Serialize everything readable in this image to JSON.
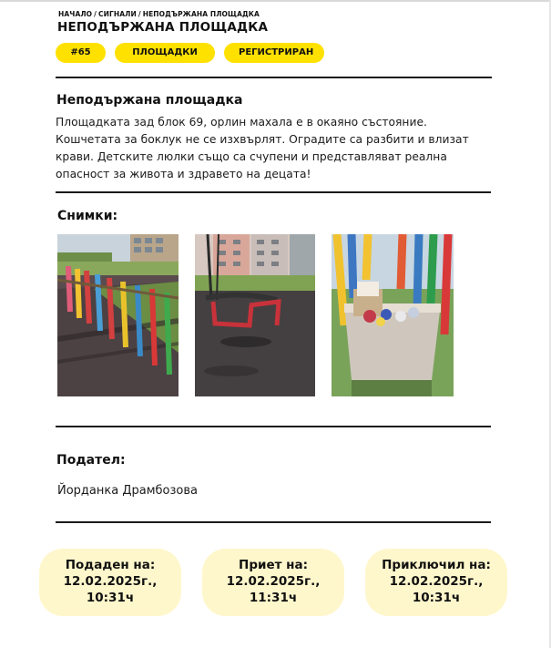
{
  "breadcrumb": {
    "home": "НАЧАЛО",
    "signals": "СИГНАЛИ",
    "current": "НЕПОДЪРЖАНА ПЛОЩАДКА",
    "separator": "/"
  },
  "page_title": "НЕПОДЪРЖАНА ПЛОЩАДКА",
  "badges": {
    "id": "#65",
    "category": "ПЛОЩАДКИ",
    "status": "РЕГИСТРИРАН"
  },
  "description": {
    "title": "Неподържана площадка",
    "text": "Площадката зад блок 69, орлин махала е в окаяно състояние. Кошчетата за боклук не се изхвърлят. Оградите са разбити и влизат крави. Детските люлки също са счупени и представляват реална опасност за живота и здравето на децата!"
  },
  "photos": {
    "title": "Снимки:",
    "items": [
      "playground-fence-photo",
      "broken-swing-photo",
      "overflowing-bin-photo"
    ]
  },
  "filer": {
    "title": "Подател:",
    "name": "Йорданка Драмбозова"
  },
  "timeline": {
    "submitted": {
      "label": "Подаден на:",
      "date": "12.02.2025г.,",
      "time": "10:31ч"
    },
    "accepted": {
      "label": "Приет на:",
      "date": "12.02.2025г.,",
      "time": "11:31ч"
    },
    "closed": {
      "label": "Приключил на:",
      "date": "12.02.2025г.,",
      "time": "10:31ч"
    }
  },
  "colors": {
    "accent": "#ffe100",
    "card_bg": "#fff7cc",
    "divider": "#1a1a1a"
  }
}
